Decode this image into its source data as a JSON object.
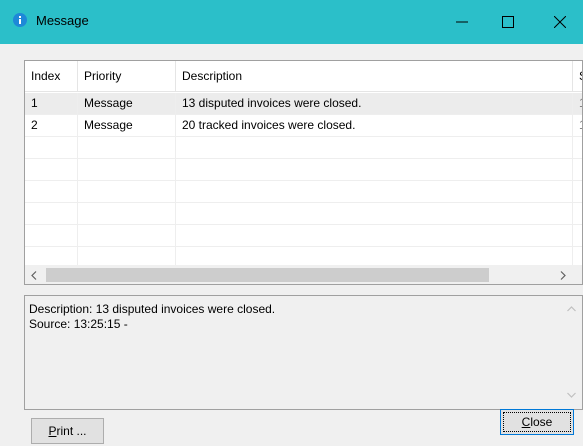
{
  "window": {
    "title": "Message",
    "colors": {
      "titlebar": "#2bbfc9",
      "info_icon": "#1e88d8"
    }
  },
  "list": {
    "columns": [
      "Index",
      "Priority",
      "Description",
      "S"
    ],
    "rows": [
      {
        "index": "1",
        "priority": "Message",
        "description": "13 disputed invoices were closed.",
        "source": "1"
      },
      {
        "index": "2",
        "priority": "Message",
        "description": "20 tracked invoices were closed.",
        "source": "1"
      }
    ],
    "selected_row": 1
  },
  "detail": {
    "line1": "Description: 13 disputed invoices were closed.",
    "line2": "Source:  13:25:15 -"
  },
  "buttons": {
    "print_first": "P",
    "print_rest": "rint ...",
    "close_first": "C",
    "close_rest": "lose"
  }
}
